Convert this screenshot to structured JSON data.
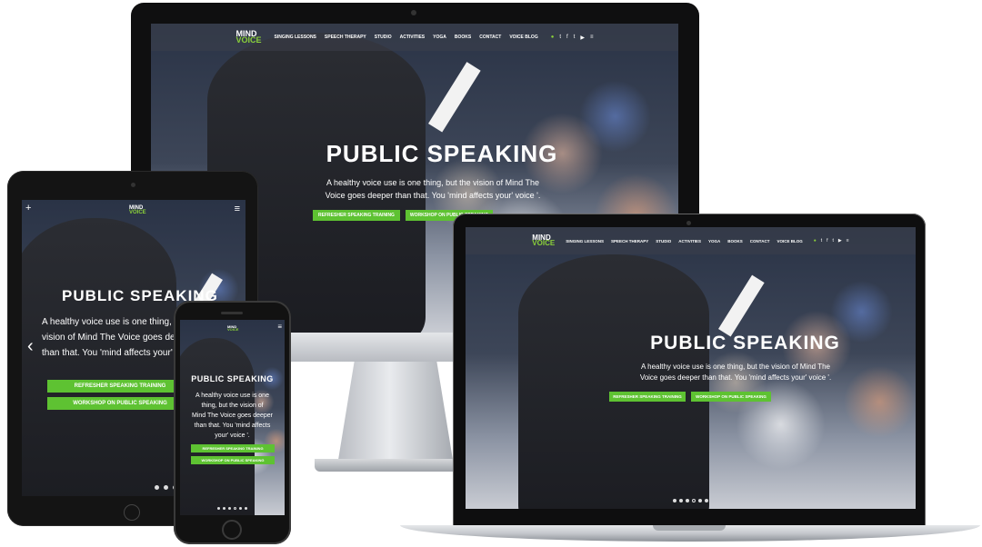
{
  "site": {
    "logo_top": "MIND",
    "logo_mid": "THE",
    "logo_bottom": "VOICE",
    "nav": [
      "SINGING LESSONS",
      "SPEECH THERAPY",
      "STUDIO",
      "ACTIVITIES",
      "YOGA",
      "BOOKS",
      "CONTACT",
      "VOICE BLOG"
    ],
    "social_icons": [
      "whatsapp-icon",
      "twitter-icon",
      "facebook-icon",
      "twitter-icon",
      "youtube-icon",
      "menu-icon"
    ],
    "hero_title": "PUBLIC SPEAKING",
    "hero_text_line1": "A healthy voice use is one thing, but the vision of Mind The",
    "hero_text_line2": "Voice goes deeper than that. You 'mind affects your' voice '.",
    "button_1": "REFRESHER SPEAKING TRAINING",
    "button_2": "WORKSHOP ON PUBLIC SPEAKING",
    "slides": 6,
    "active_slide": 4
  },
  "tablet": {
    "hero_text_line1": "A healthy voice use is one thing, but the",
    "hero_text_line2": "vision of Mind The Voice goes deeper",
    "hero_text_line3": "than that. You 'mind affects your' voice '.",
    "button_1": "REFRESHER SPEAKING TRAINING",
    "button_2": "WORKSHOP ON PUBLIC SPEAKING"
  },
  "phone": {
    "hero_text_line1": "A healthy voice use is one",
    "hero_text_line2": "thing, but the vision of",
    "hero_text_line3": "Mind The Voice goes deeper",
    "hero_text_line4": "than that. You 'mind affects",
    "hero_text_line5": "your' voice '."
  },
  "colors": {
    "accent_green": "#5ec232",
    "logo_green": "#8bd03a",
    "device_black": "#111111",
    "laptop_silver": "#c9ccd1"
  }
}
